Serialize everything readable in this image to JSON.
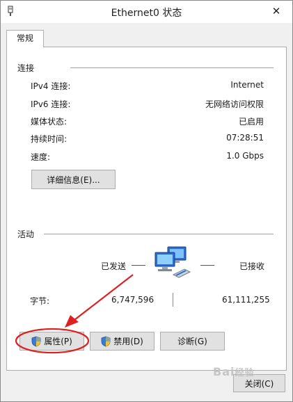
{
  "window": {
    "title": "Ethernet0 状态",
    "close_glyph": "✕"
  },
  "tabs": [
    {
      "label": "常规"
    }
  ],
  "connection": {
    "section_label": "连接",
    "rows": [
      {
        "label": "IPv4 连接:",
        "value": "Internet"
      },
      {
        "label": "IPv6 连接:",
        "value": "无网络访问权限"
      },
      {
        "label": "媒体状态:",
        "value": "已启用"
      },
      {
        "label": "持续时间:",
        "value": "07:28:51"
      },
      {
        "label": "速度:",
        "value": "1.0 Gbps"
      }
    ],
    "details_button": "详细信息(E)..."
  },
  "activity": {
    "section_label": "活动",
    "sent_label": "已发送",
    "received_label": "已接收",
    "bytes_label": "字节:",
    "bytes_sent": "6,747,596",
    "bytes_received": "61,111,255",
    "network_icon": "network-computers-icon"
  },
  "actions": {
    "properties": "属性(P)",
    "disable": "禁用(D)",
    "diagnose": "诊断(G)",
    "close": "关闭(C)"
  },
  "annotation": {
    "highlight_color": "#e02020"
  },
  "watermark_text": "Bai经验"
}
